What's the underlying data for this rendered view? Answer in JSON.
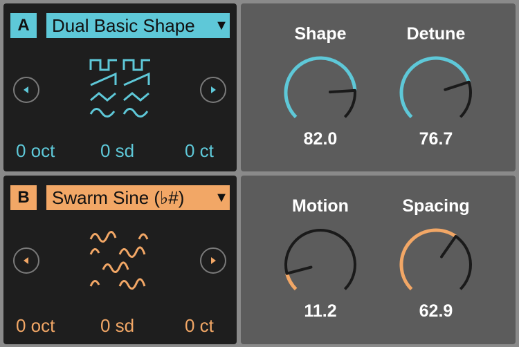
{
  "osc_a": {
    "badge": "A",
    "waveform": "Dual Basic Shape",
    "octave": "0 oct",
    "semitone": "0 sd",
    "cents": "0 ct",
    "color": "#5ec8d8",
    "icons": {
      "prev": "chevron-left-icon",
      "next": "chevron-right-icon",
      "wave": "dual-basic-shape-waveform-icon"
    }
  },
  "osc_b": {
    "badge": "B",
    "waveform": "Swarm Sine  (♭#)",
    "octave": "0 oct",
    "semitone": "0 sd",
    "cents": "0 ct",
    "color": "#f2a766",
    "icons": {
      "prev": "chevron-left-icon",
      "next": "chevron-right-icon",
      "wave": "swarm-sine-waveform-icon"
    }
  },
  "knobs_a": {
    "shape": {
      "label": "Shape",
      "value": "82.0",
      "fraction": 0.82
    },
    "detune": {
      "label": "Detune",
      "value": "76.7",
      "fraction": 0.767
    }
  },
  "knobs_b": {
    "motion": {
      "label": "Motion",
      "value": "11.2",
      "fraction": 0.112
    },
    "spacing": {
      "label": "Spacing",
      "value": "62.9",
      "fraction": 0.629
    }
  },
  "colors": {
    "panel_dark": "#1e1e1e",
    "panel_gray": "#5c5c5c",
    "track": "#1a1a1a"
  }
}
